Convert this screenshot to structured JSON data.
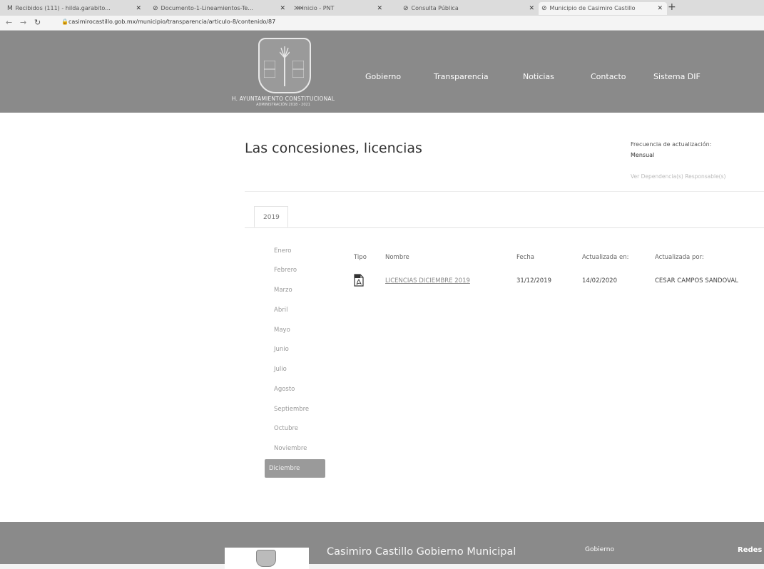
{
  "browser": {
    "tabs": [
      {
        "icon": "M",
        "label": "Recibidos (111) - hilda.garabito..."
      },
      {
        "icon": "⊘",
        "label": "Documento-1-Lineamientos-Te..."
      },
      {
        "icon": "⋙",
        "label": "Inicio - PNT"
      },
      {
        "icon": "⊘",
        "label": "Consulta Pública"
      },
      {
        "icon": "⊘",
        "label": "Municipio de Casimiro Castillo"
      }
    ],
    "new_tab": "+",
    "url": "casimirocastillo.gob.mx/municipio/transparencia/articulo-8/contenido/87"
  },
  "header": {
    "logo_caption": "H. AYUNTAMIENTO CONSTITUCIONAL",
    "logo_subcaption": "ADMINISTRACIÓN 2018 - 2021",
    "nav": [
      "Gobierno",
      "Transparencia",
      "Noticias",
      "Contacto",
      "Sistema DIF"
    ]
  },
  "content": {
    "title": "Las concesiones, licencias",
    "frequency_label": "Frecuencia de actualización:",
    "frequency_value": "Mensual",
    "dependencies_link": "Ver Dependencia(s) Responsable(s)",
    "year_tab": "2019",
    "months": [
      "Enero",
      "Febrero",
      "Marzo",
      "Abril",
      "Mayo",
      "Junio",
      "Julio",
      "Agosto",
      "Septiembre",
      "Octubre",
      "Noviembre",
      "Diciembre"
    ],
    "active_month": "Diciembre",
    "table": {
      "headers": [
        "Tipo",
        "Nombre",
        "Fecha",
        "Actualizada en:",
        "Actualizada por:"
      ],
      "rows": [
        {
          "type_icon": "pdf-icon",
          "name": "LICENCIAS DICIEMBRE 2019",
          "date": "31/12/2019",
          "updated_on": "14/02/2020",
          "updated_by": "CESAR CAMPOS SANDOVAL"
        }
      ]
    }
  },
  "footer": {
    "title": "Casimiro Castillo Gobierno Municipal",
    "gobierno": "Gobierno",
    "redes": "Redes"
  }
}
